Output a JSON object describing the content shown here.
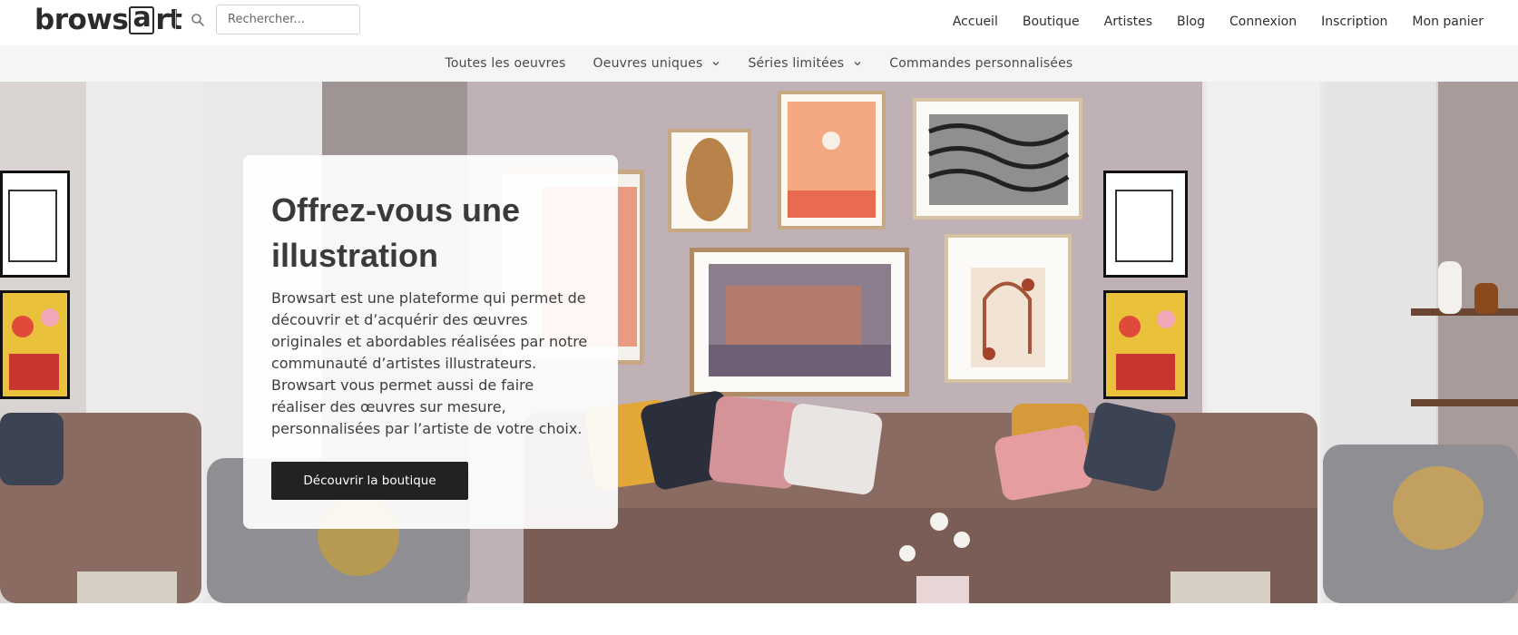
{
  "brand": {
    "logo_part1": "brows",
    "logo_boxed": "a",
    "logo_part2": "rt"
  },
  "search": {
    "placeholder": "Rechercher..."
  },
  "main_nav": [
    {
      "label": "Accueil"
    },
    {
      "label": "Boutique"
    },
    {
      "label": "Artistes"
    },
    {
      "label": "Blog"
    },
    {
      "label": "Connexion"
    },
    {
      "label": "Inscription"
    },
    {
      "label": "Mon panier"
    }
  ],
  "sub_nav": [
    {
      "label": "Toutes les oeuvres",
      "has_dropdown": false
    },
    {
      "label": "Oeuvres uniques",
      "has_dropdown": true
    },
    {
      "label": "Séries limitées",
      "has_dropdown": true
    },
    {
      "label": "Commandes personnalisées",
      "has_dropdown": false
    }
  ],
  "hero": {
    "title_line1": "Offrez-vous une",
    "title_line2": "illustration",
    "paragraph1": "Browsart est une plateforme qui permet de découvrir et d’acquérir des œuvres originales et abordables réalisées par notre communauté d’artistes illustrateurs.",
    "paragraph2": "Browsart vous permet aussi de faire réaliser des œuvres sur mesure, personnalisées par l’artiste de votre choix.",
    "cta_label": "Découvrir la boutique"
  },
  "colors": {
    "text_dark": "#2f2f2f",
    "button_bg": "#222222",
    "subnav_bg": "#f4f5f7",
    "wall": "#bfb1b5",
    "sofa": "#8a6b62"
  },
  "icons": {
    "search": "search-icon",
    "dropdown": "chevron-down-icon"
  }
}
